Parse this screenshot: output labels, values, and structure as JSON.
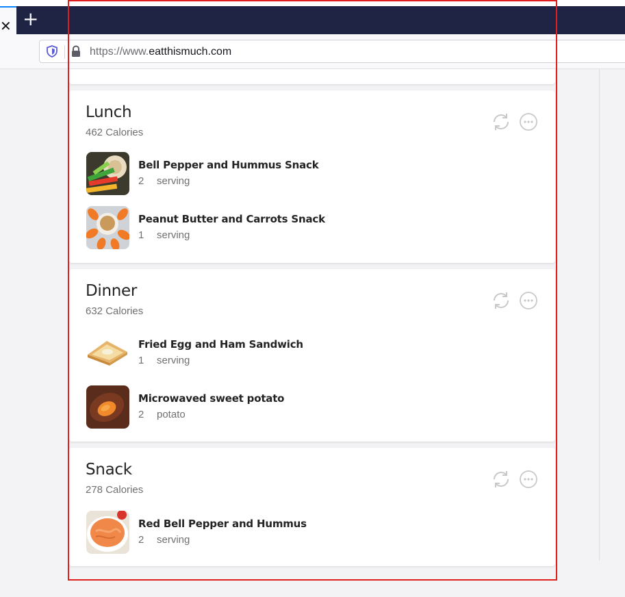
{
  "browser": {
    "tab_close_glyph": "✕",
    "new_tab_glyph": "+",
    "url_prefix": "https://www.",
    "url_domain": "eatthismuch.com",
    "icons": [
      "tracking-shield-icon",
      "lock-icon",
      "close-icon",
      "plus-icon"
    ]
  },
  "colors": {
    "tabstrip": "#1f2344",
    "highlight": "#e01e1e",
    "text_primary": "#232323",
    "text_secondary": "#707070",
    "icon_gray": "#c8c8c8"
  },
  "meals": [
    {
      "title": "Lunch",
      "calories": "462 Calories",
      "foods": [
        {
          "name": "Bell Pepper and Hummus Snack",
          "qty": "2",
          "unit": "serving",
          "image": "bell-pepper-hummus-image"
        },
        {
          "name": "Peanut Butter and Carrots Snack",
          "qty": "1",
          "unit": "serving",
          "image": "peanut-butter-carrots-image"
        }
      ]
    },
    {
      "title": "Dinner",
      "calories": "632 Calories",
      "foods": [
        {
          "name": "Fried Egg and Ham Sandwich",
          "qty": "1",
          "unit": "serving",
          "image": "fried-egg-ham-sandwich-image"
        },
        {
          "name": "Microwaved sweet potato",
          "qty": "2",
          "unit": "potato",
          "image": "sweet-potato-image"
        }
      ]
    },
    {
      "title": "Snack",
      "calories": "278 Calories",
      "foods": [
        {
          "name": "Red Bell Pepper and Hummus",
          "qty": "2",
          "unit": "serving",
          "image": "red-pepper-hummus-image"
        }
      ]
    }
  ],
  "meal_actions": [
    "regenerate-icon",
    "more-options-icon"
  ]
}
